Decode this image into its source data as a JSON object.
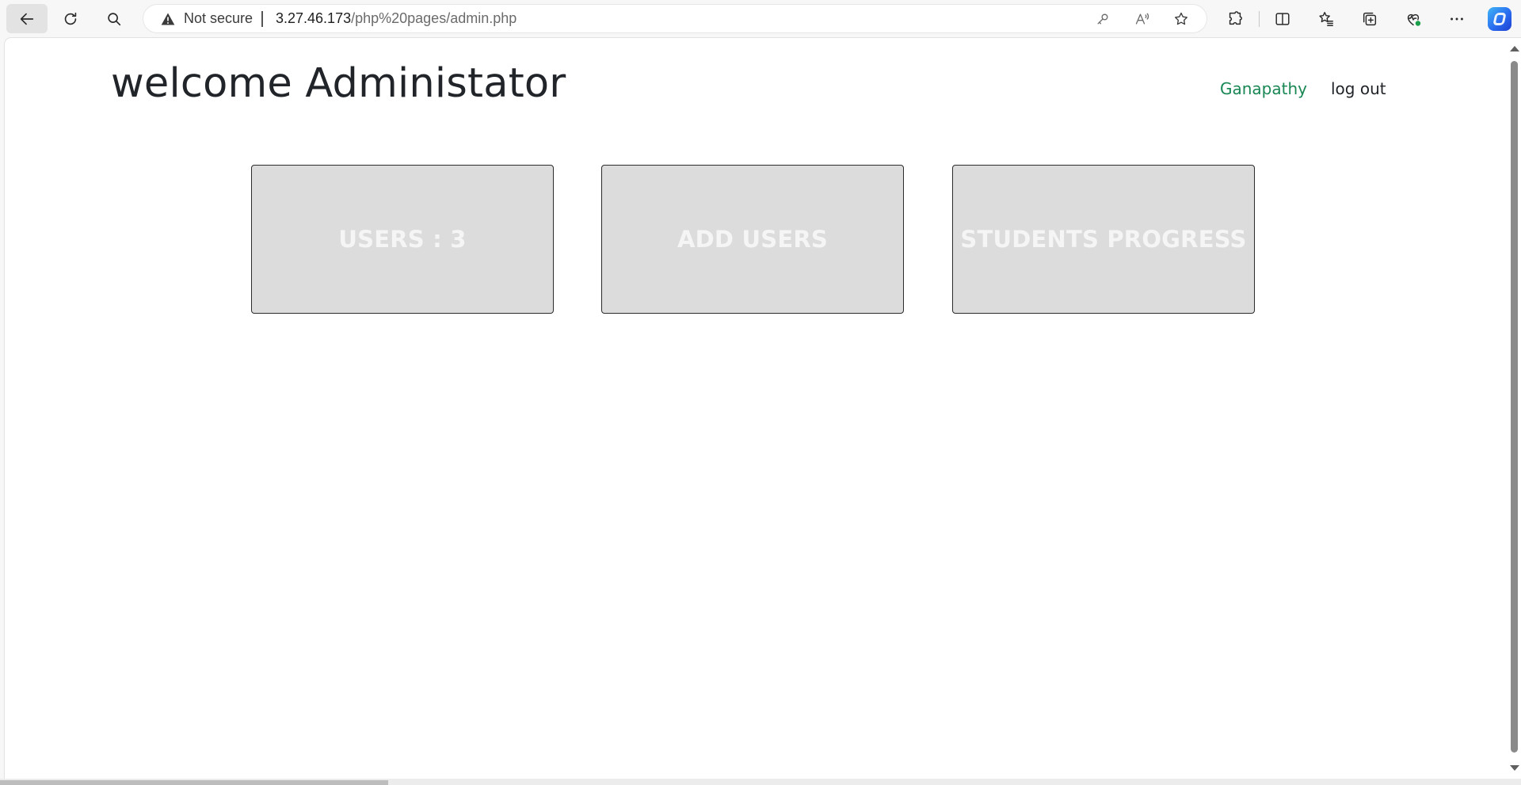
{
  "browser": {
    "address_warning": "Not secure",
    "url_host": "3.27.46.173",
    "url_path": "/php%20pages/admin.php",
    "icons": {
      "back": "back-arrow-icon",
      "refresh": "refresh-icon",
      "search": "search-icon",
      "password": "key-icon",
      "read_aloud": "read-aloud-icon",
      "favorite": "star-icon",
      "extensions": "puzzle-icon",
      "split_screen": "split-screen-icon",
      "favorites": "favorites-icon",
      "collections": "collections-icon",
      "health": "browser-essentials-icon",
      "more": "more-icon",
      "copilot": "copilot-icon"
    }
  },
  "header": {
    "title": "welcome Administator",
    "username": "Ganapathy",
    "logout_label": "log out"
  },
  "cards": [
    {
      "label": "USERS : 3"
    },
    {
      "label": "ADD USERS"
    },
    {
      "label": "STUDENTS PROGRESS"
    }
  ],
  "colors": {
    "accent_user_link": "#198754",
    "card_bg": "#dcdcdc",
    "card_text": "#f5f5f5"
  }
}
